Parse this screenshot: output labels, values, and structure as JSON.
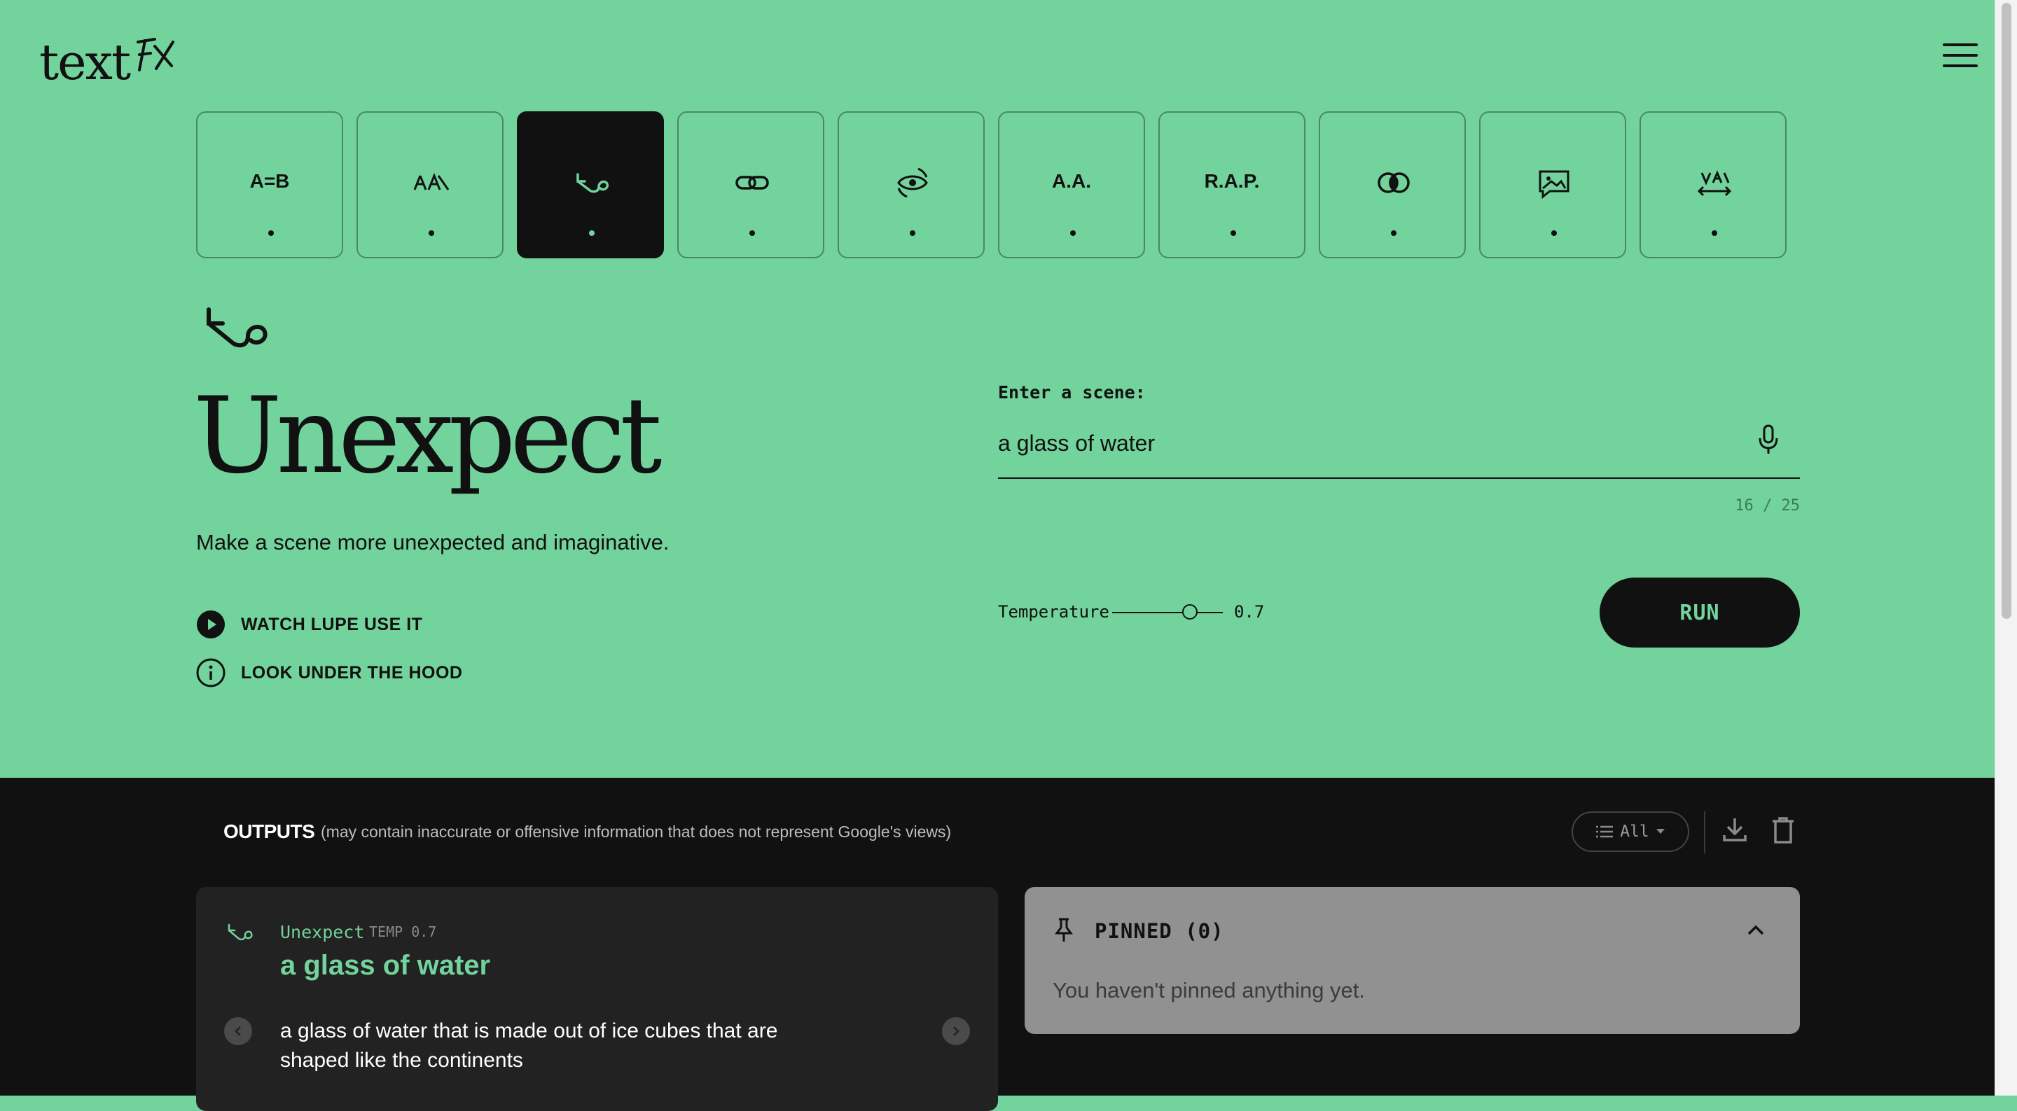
{
  "brand": {
    "logo_text": "text",
    "logo_mark": "FX"
  },
  "tools": [
    {
      "label": "A=B",
      "icon": ""
    },
    {
      "label": "",
      "icon": "semantic-squeeze-icon"
    },
    {
      "label": "",
      "icon": "unexpect-icon",
      "active": true
    },
    {
      "label": "",
      "icon": "chain-link-icon"
    },
    {
      "label": "",
      "icon": "pov-eye-icon"
    },
    {
      "label": "A.A.",
      "icon": ""
    },
    {
      "label": "R.A.P.",
      "icon": ""
    },
    {
      "label": "",
      "icon": "intersection-icon"
    },
    {
      "label": "",
      "icon": "scene-image-icon"
    },
    {
      "label": "",
      "icon": "fuse-icon"
    }
  ],
  "tool": {
    "title": "Unexpect",
    "description": "Make a scene more unexpected and imaginative.",
    "watch_label": "WATCH LUPE USE IT",
    "hood_label": "LOOK UNDER THE HOOD"
  },
  "input": {
    "label": "Enter a scene:",
    "value": "a glass of water",
    "char_count": "16 / 25"
  },
  "temperature": {
    "label": "Temperature",
    "value": "0.7",
    "level": 0.7
  },
  "run_label": "RUN",
  "outputs": {
    "title": "OUTPUTS",
    "disclaimer": "(may contain inaccurate or offensive information that does not represent Google's views)",
    "filter_label": "All",
    "card": {
      "tool": "Unexpect",
      "temp": "TEMP 0.7",
      "scene": "a glass of water",
      "result": "a glass of water that is made out of ice cubes that are shaped like the continents"
    },
    "pinned": {
      "title": "PINNED (0)",
      "empty": "You haven't pinned anything yet."
    }
  },
  "colors": {
    "accent": "#72d39c",
    "dark": "#111111",
    "card": "#222222",
    "pinned": "#919191"
  }
}
